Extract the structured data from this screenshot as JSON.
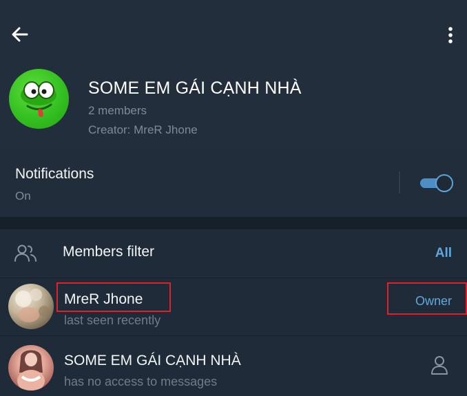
{
  "header": {
    "back_icon": "arrow-left-icon",
    "more_icon": "more-vertical-icon",
    "group_title": "SOME EM GÁI CẠNH NHÀ",
    "members_count": "2 members",
    "creator": "Creator: MreR Jhone"
  },
  "notifications": {
    "label": "Notifications",
    "status": "On",
    "enabled": true
  },
  "members_filter": {
    "icon": "people-icon",
    "label": "Members filter",
    "value": "All"
  },
  "members": [
    {
      "name": "MreR Jhone",
      "status": "last seen recently",
      "role": "Owner"
    },
    {
      "name": "SOME EM GÁI CẠNH NHÀ",
      "status": "has no access to messages",
      "action_icon": "person-icon"
    }
  ],
  "colors": {
    "background": "#1d2733",
    "accent": "#5fa8e0",
    "highlight": "#e1212a"
  }
}
